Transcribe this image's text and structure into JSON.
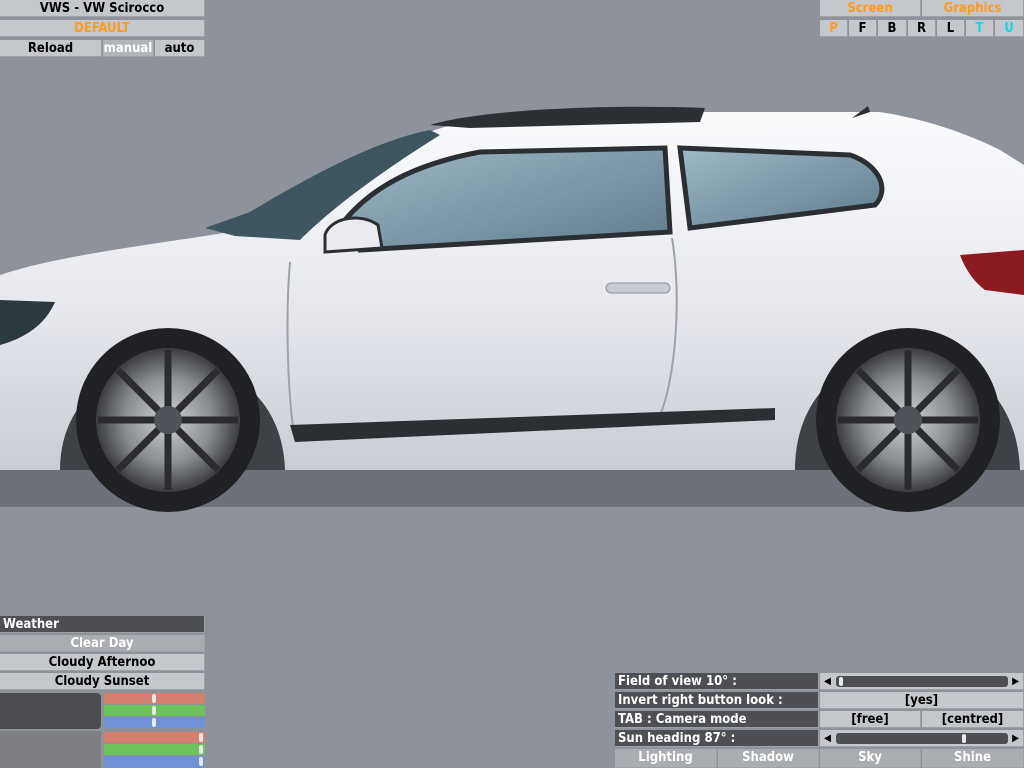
{
  "top_left": {
    "title": "VWS - VW Scirocco",
    "config_name": "DEFAULT",
    "reload_label": "Reload",
    "manual_label": "manual",
    "auto_label": "auto"
  },
  "top_right": {
    "screen_label": "Screen",
    "graphics_label": "Graphics",
    "view_buttons": [
      "P",
      "F",
      "B",
      "R",
      "L",
      "T",
      "U"
    ]
  },
  "weather": {
    "header": "Weather",
    "options": [
      "Clear Day",
      "Cloudy Afternoo",
      "Cloudy Sunset"
    ],
    "slider_colors": [
      "#d5806f",
      "#6cc35a",
      "#6d93d6",
      "#d5806f",
      "#6cc35a",
      "#6d93d6"
    ]
  },
  "settings": {
    "fov_label": "Field of view 10° :",
    "invert_label": "Invert right button look :",
    "invert_value": "[yes]",
    "camera_label": "TAB : Camera mode",
    "camera_free": "[free]",
    "camera_centred": "[centred]",
    "sun_label": "Sun heading 87° :",
    "tabs": [
      "Lighting",
      "Shadow",
      "Sky",
      "Shine"
    ]
  },
  "colors": {
    "background": "#8e929a",
    "accent_orange": "#ff9b1e",
    "accent_cyan": "#12d9e8",
    "panel_dark": "#4d4f54",
    "panel_light": "#c4c7cb"
  }
}
